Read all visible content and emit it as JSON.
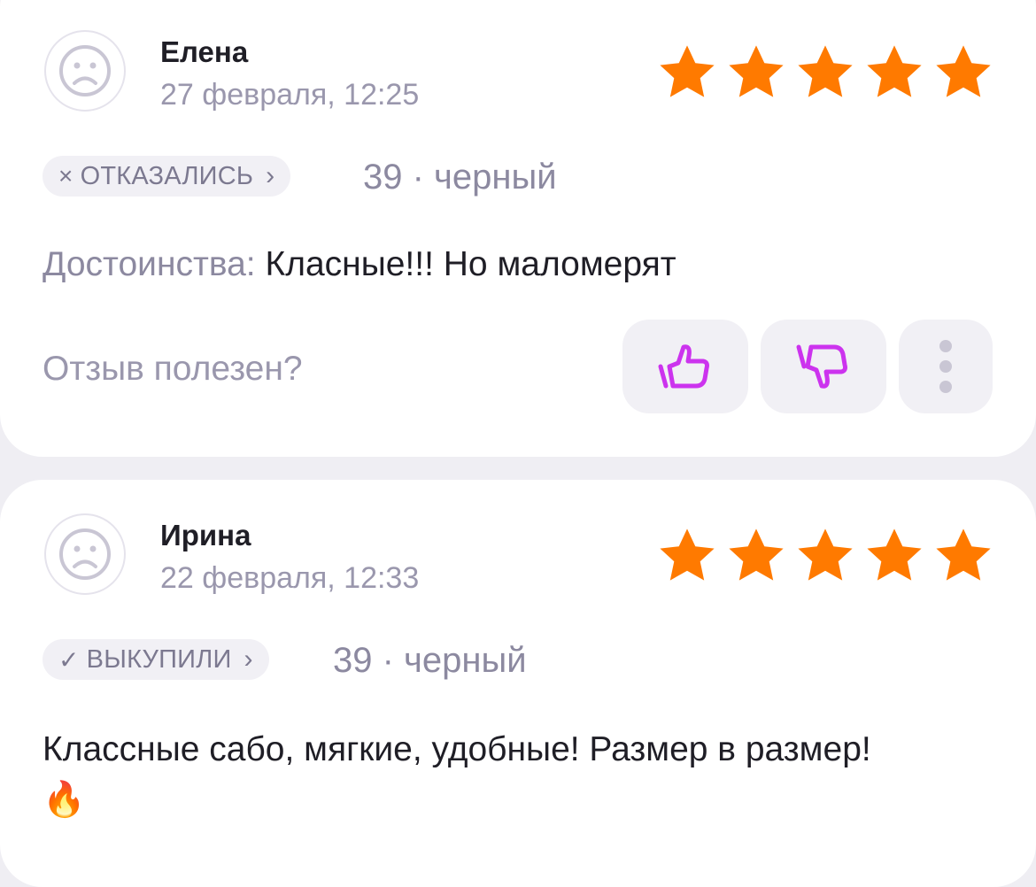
{
  "colors": {
    "star": "#ff7a00",
    "vote_icon": "#cc33ee",
    "badge_bg": "#f1f0f5",
    "muted": "#9a97ad"
  },
  "reviews": [
    {
      "author": "Елена",
      "date": "27 февраля, 12:25",
      "rating": 5,
      "status_icon": "×",
      "status": "ОТКАЗАЛИСЬ",
      "variant": "39 · черный",
      "pros_label": "Достоинства:",
      "text": "Класные!!! Но маломерят",
      "helpful_prompt": "Отзыв полезен?"
    },
    {
      "author": "Ирина",
      "date": "22 февраля, 12:33",
      "rating": 5,
      "status_icon": "✓",
      "status": "ВЫКУПИЛИ",
      "variant": "39 · черный",
      "text": "Классные сабо, мягкие, удобные! Размер в размер!",
      "emoji": "🔥"
    }
  ]
}
